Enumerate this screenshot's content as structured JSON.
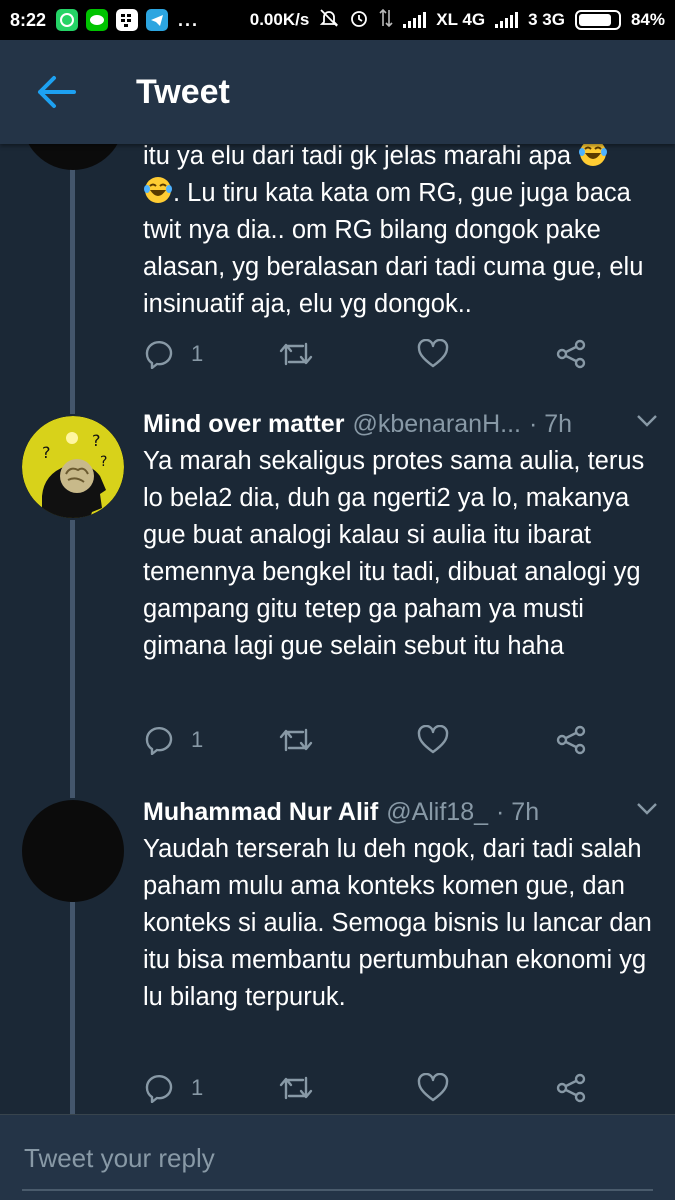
{
  "status_bar": {
    "time": "8:22",
    "apps": [
      "WA",
      "LINE",
      "BBM",
      "TG"
    ],
    "more": "...",
    "speed": "0.00K/s",
    "carrier1": "XL 4G",
    "carrier2": "3 3G",
    "battery": "84%"
  },
  "header": {
    "title": "Tweet"
  },
  "tweets": [
    {
      "text_line1": "itu ya elu dari tadi gk jelas marahi apa",
      "text_rest": ". Lu tiru kata kata om RG, gue juga baca twit nya dia.. om RG bilang dongok pake alasan, yg beralasan dari tadi cuma gue, elu insinuatif aja, elu yg dongok..",
      "reply_count": "1"
    },
    {
      "name": "Mind over matter",
      "handle": "@kbenaranH...",
      "time": "· 7h",
      "text": "Ya marah sekaligus protes sama aulia, terus lo bela2 dia, duh ga ngerti2 ya lo, makanya gue buat analogi kalau si aulia itu ibarat temennya bengkel itu tadi, dibuat analogi yg gampang gitu tetep ga paham ya musti gimana lagi gue selain sebut itu haha",
      "reply_count": "1"
    },
    {
      "name": "Muhammad Nur Alif",
      "handle": "@Alif18_",
      "time": "· 7h",
      "text": "Yaudah terserah lu deh ngok, dari tadi salah paham mulu ama konteks komen gue, dan konteks si aulia. Semoga bisnis lu lancar dan itu bisa membantu pertumbuhan ekonomi yg lu bilang terpuruk.",
      "reply_count": "1"
    }
  ],
  "reply_box": {
    "placeholder": "Tweet your reply"
  },
  "colors": {
    "background": "#1b2836",
    "header": "#243447",
    "accent": "#1da1f2",
    "secondary_text": "#8899a6"
  },
  "icons": [
    "back-arrow-icon",
    "reply-icon",
    "retweet-icon",
    "like-icon",
    "share-icon",
    "chevron-down-icon",
    "laughing-emoji-icon"
  ]
}
